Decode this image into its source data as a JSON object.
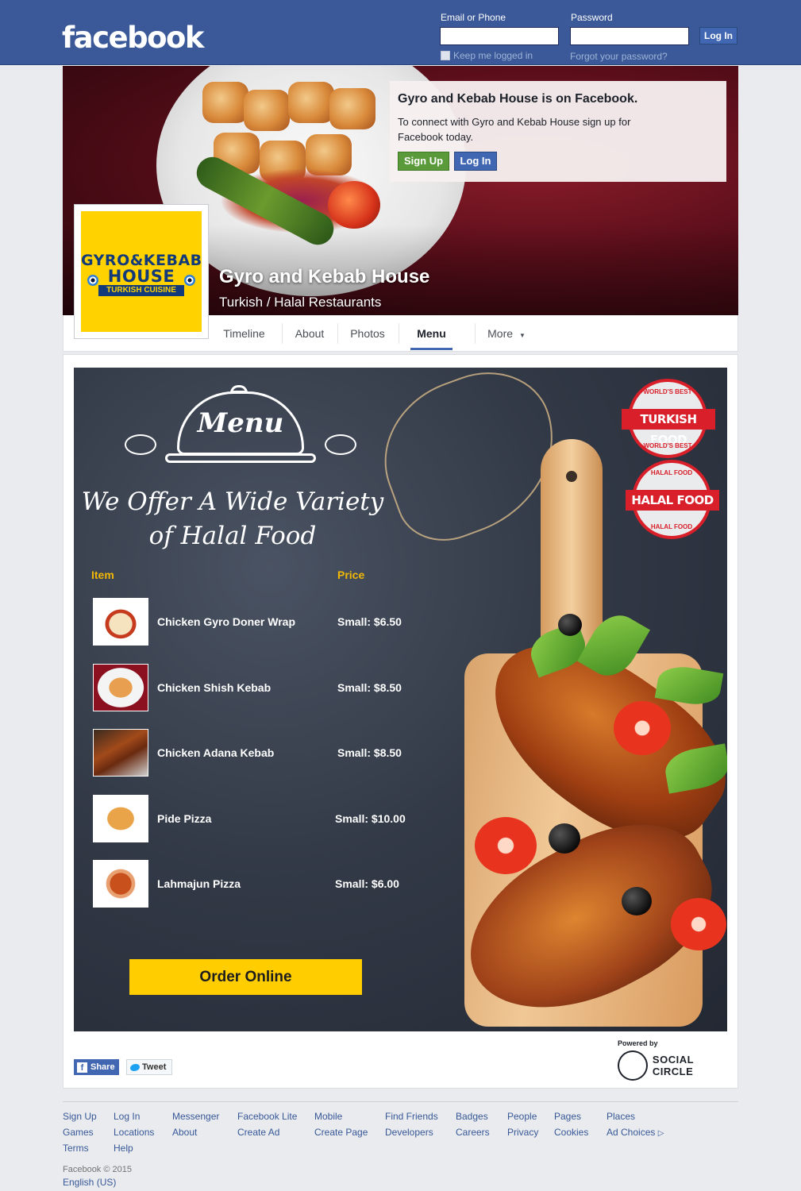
{
  "header": {
    "logo": "facebook",
    "email_label": "Email or Phone",
    "password_label": "Password",
    "login_button": "Log In",
    "keep_logged_in": "Keep me logged in",
    "forgot_password": "Forgot your password?"
  },
  "page": {
    "name": "Gyro and Kebab House",
    "category": "Turkish / Halal Restaurants",
    "logo_line1": "GYRO&KEBAB",
    "logo_line2": "HOUSE",
    "logo_line3": "TURKISH CUISINE"
  },
  "signup_prompt": {
    "title": "Gyro and Kebab House is on Facebook.",
    "text": "To connect with Gyro and Kebab House sign up for Facebook today.",
    "signup_button": "Sign Up",
    "login_button": "Log In"
  },
  "tabs": [
    {
      "label": "Timeline"
    },
    {
      "label": "About"
    },
    {
      "label": "Photos"
    },
    {
      "label": "Menu"
    },
    {
      "label": "More"
    }
  ],
  "menu": {
    "title": "Menu",
    "headline_line1": "We Offer A Wide Variety",
    "headline_line2": "of Halal Food",
    "item_header": "Item",
    "price_header": "Price",
    "items": [
      {
        "name": "Chicken Gyro Doner Wrap",
        "price": "Small: $6.50"
      },
      {
        "name": "Chicken Shish Kebab",
        "price": "Small: $8.50"
      },
      {
        "name": "Chicken Adana Kebab",
        "price": "Small: $8.50"
      },
      {
        "name": "Pide Pizza",
        "price": "Small: $10.00"
      },
      {
        "name": "Lahmajun Pizza",
        "price": "Small: $6.00"
      }
    ],
    "order_button": "Order Online",
    "stamp1_main": "TURKISH FOOD",
    "stamp1_small": "WORLD'S BEST",
    "stamp2_main": "HALAL FOOD",
    "stamp2_small": "HALAL FOOD"
  },
  "social": {
    "share": "Share",
    "tweet": "Tweet",
    "powered_by": "Powered by",
    "brand": "SOCIAL CIRCLE"
  },
  "footer": {
    "links": [
      [
        "Sign Up",
        "Games",
        "Terms"
      ],
      [
        "Log In",
        "Locations",
        "Help"
      ],
      [
        "Messenger",
        "About"
      ],
      [
        "Facebook Lite",
        "Create Ad"
      ],
      [
        "Mobile",
        "Create Page"
      ],
      [
        "Find Friends",
        "Developers"
      ],
      [
        "Badges",
        "Careers"
      ],
      [
        "People",
        "Privacy"
      ],
      [
        "Pages",
        "Cookies"
      ],
      [
        "Places",
        "Ad Choices"
      ]
    ],
    "copyright": "Facebook © 2015",
    "language": "English (US)"
  },
  "colors": {
    "brand_blue": "#3b5998",
    "button_green": "#5b9a3a",
    "order_yellow": "#ffcd00",
    "header_gold": "#f2b705"
  }
}
